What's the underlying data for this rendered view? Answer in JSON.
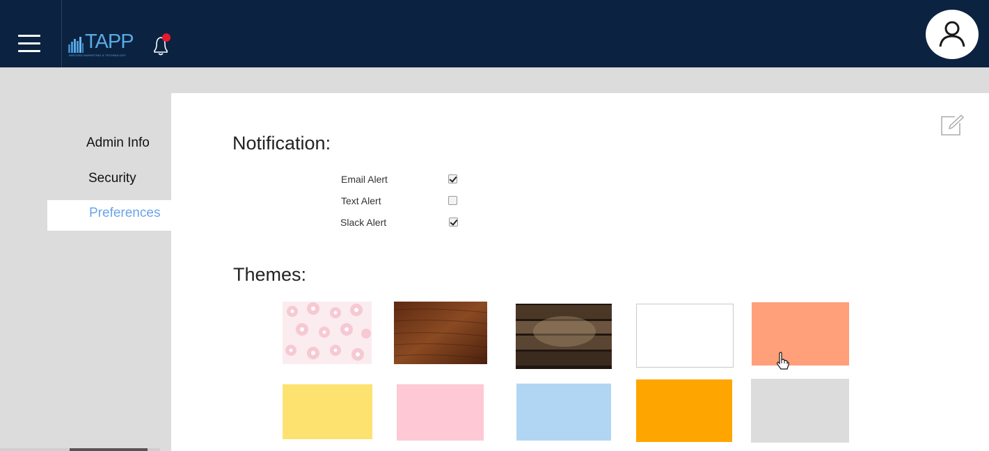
{
  "header": {
    "logo_text": "TAPP",
    "logo_tagline": "INBOUND MARKETING & TECHNOLOGY",
    "menu_icon": "hamburger-icon",
    "bell_icon": "bell-icon",
    "avatar_icon": "user-icon",
    "colors": {
      "background": "#0b2340",
      "logo": "#5aa9e6",
      "notification_dot": "#e8192c"
    }
  },
  "sidebar": {
    "items": [
      {
        "label": "Admin Info",
        "active": false
      },
      {
        "label": "Security",
        "active": false
      },
      {
        "label": "Preferences",
        "active": true
      }
    ],
    "active_color": "#6aa4e8"
  },
  "notification": {
    "title": "Notification:",
    "alerts": [
      {
        "label": "Email Alert",
        "checked": true
      },
      {
        "label": "Text Alert",
        "checked": false
      },
      {
        "label": "Slack Alert",
        "checked": true
      }
    ]
  },
  "themes": {
    "title": "Themes:",
    "swatches": [
      {
        "name": "pink-floral",
        "color": "#f7dde3"
      },
      {
        "name": "brown-wood",
        "color": "#7a3d1c"
      },
      {
        "name": "dark-planks",
        "color": "#3a2a1d"
      },
      {
        "name": "white",
        "color": "#ffffff"
      },
      {
        "name": "salmon",
        "color": "#ffa07a"
      },
      {
        "name": "yellow",
        "color": "#fde270"
      },
      {
        "name": "pink",
        "color": "#fec8d5"
      },
      {
        "name": "light-blue",
        "color": "#b1d6f3"
      },
      {
        "name": "orange",
        "color": "#ffa500"
      },
      {
        "name": "light-gray",
        "color": "#dcdcdc"
      }
    ]
  },
  "toolbar": {
    "edit_icon": "edit-icon"
  }
}
